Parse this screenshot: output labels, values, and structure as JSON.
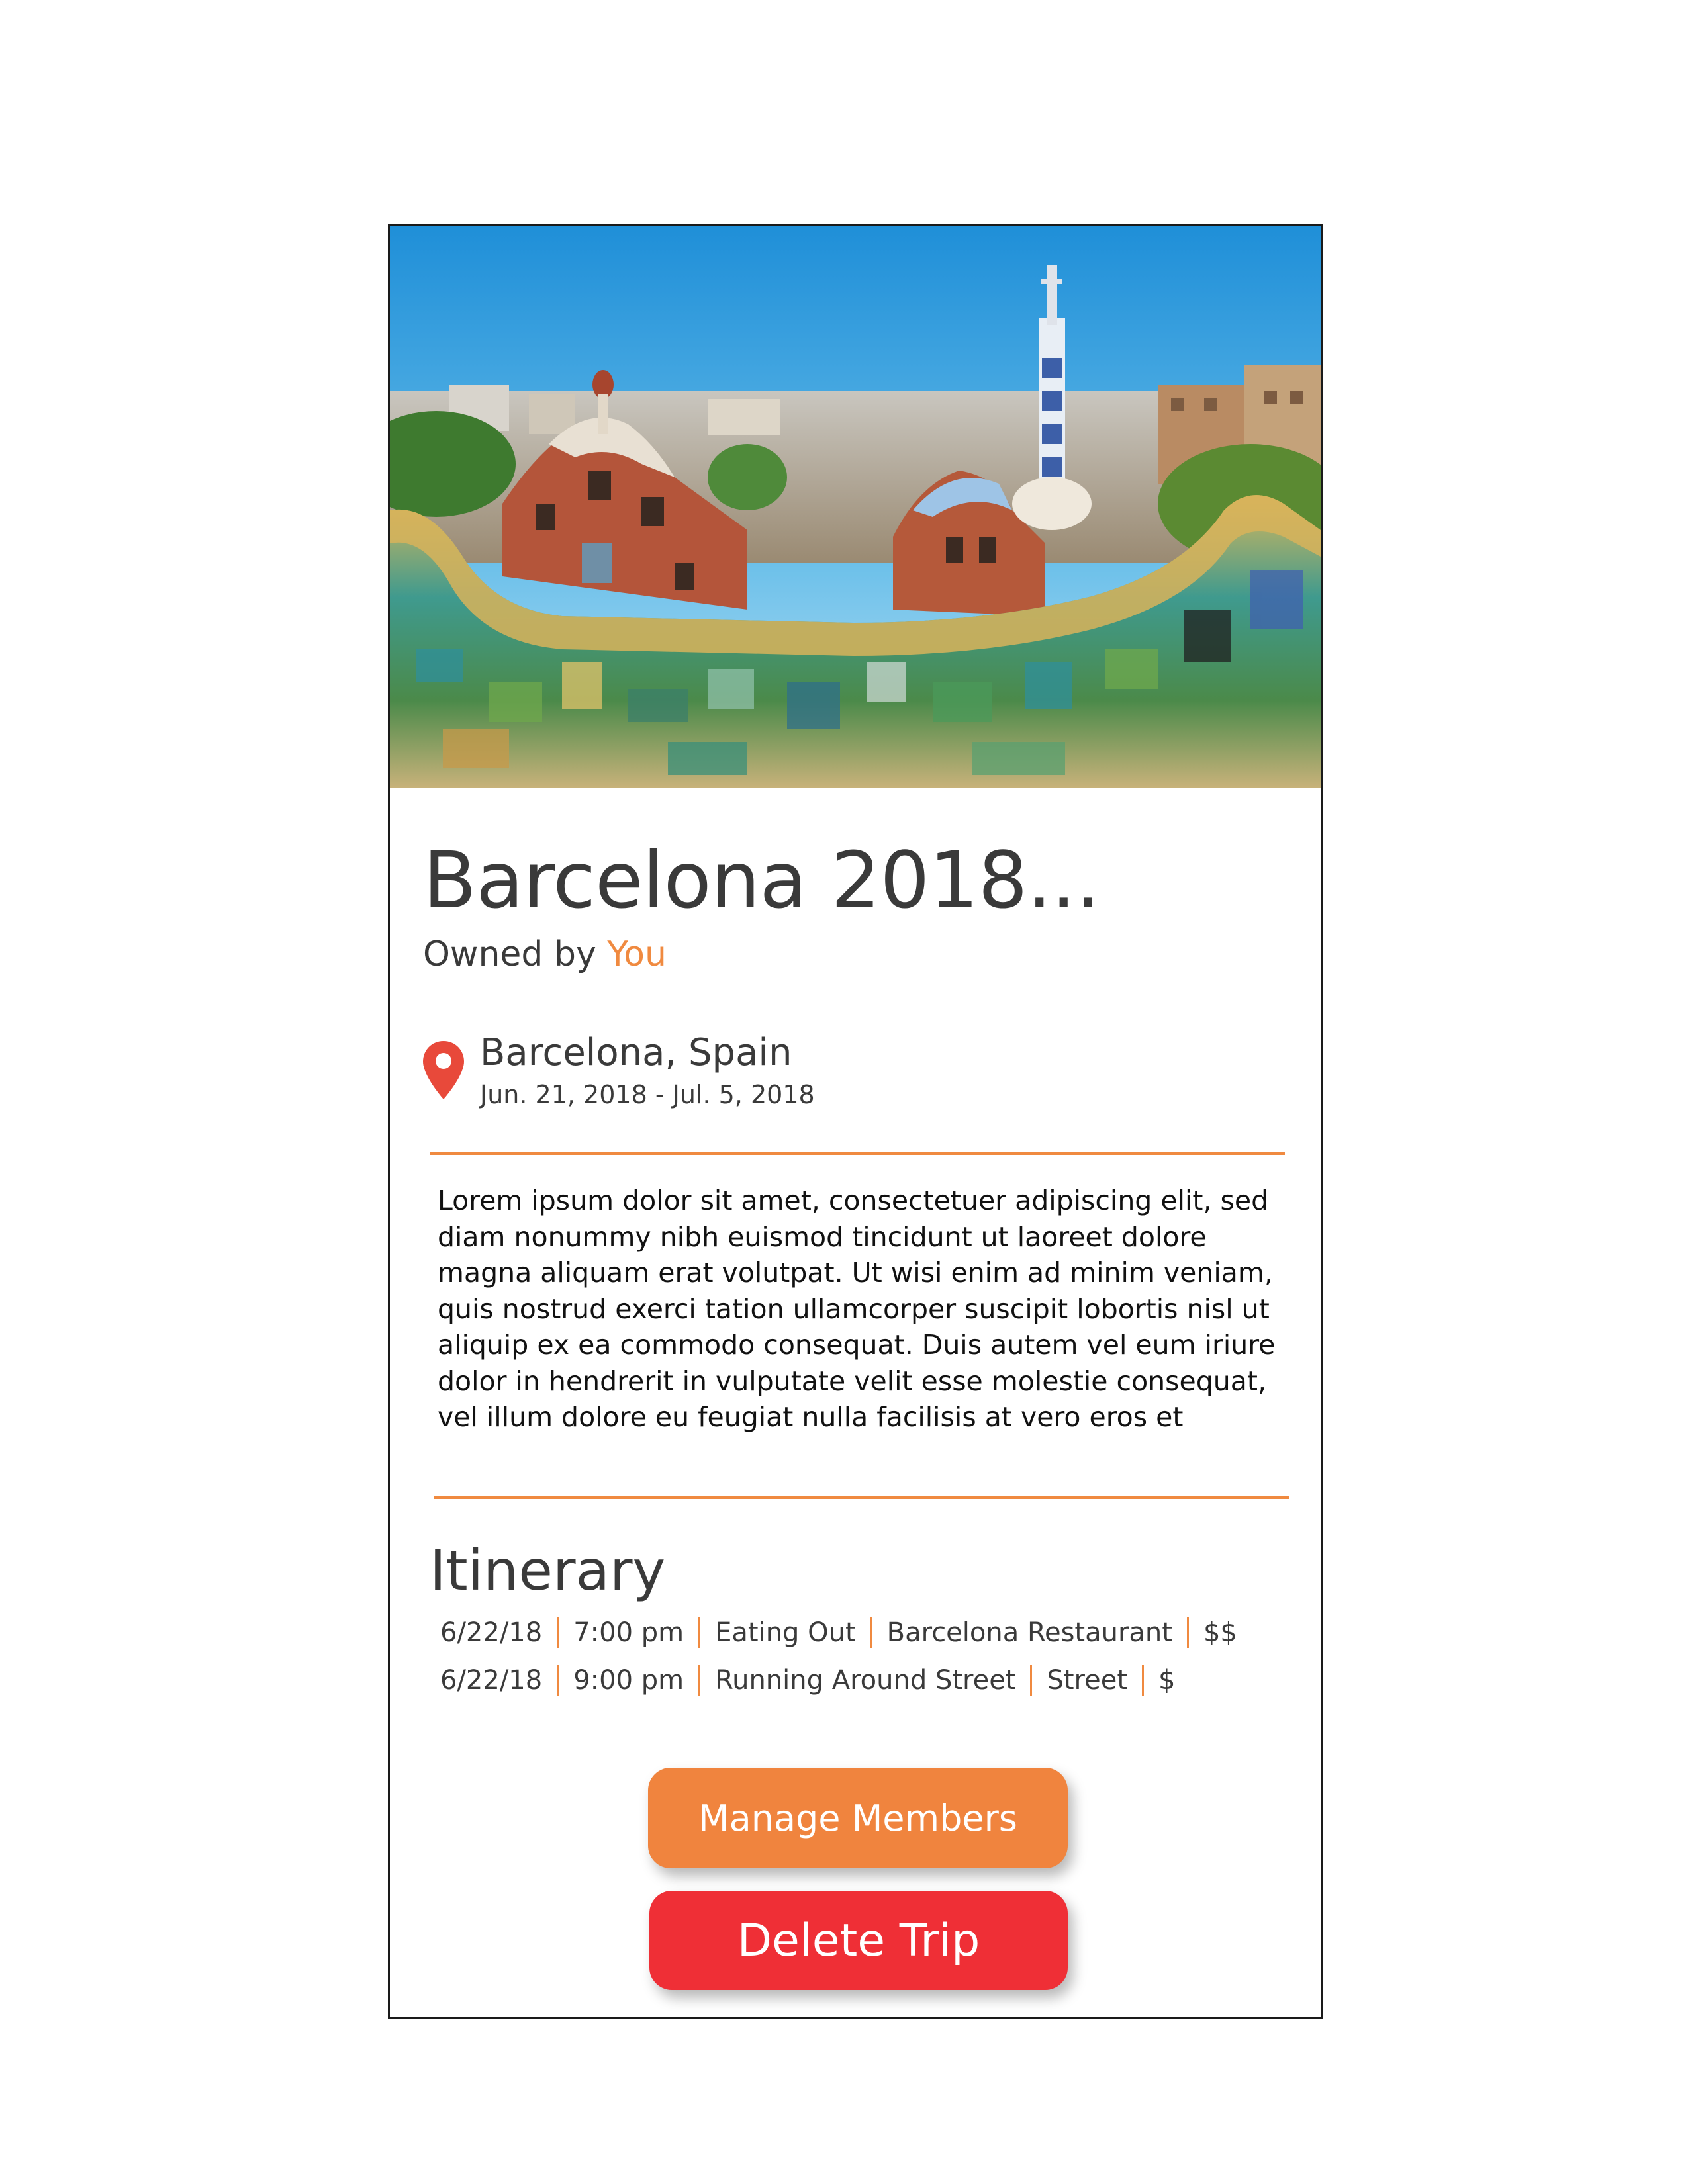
{
  "trip": {
    "title": "Barcelona 2018...",
    "owned_by_label": "Owned by",
    "owner": "You"
  },
  "location": {
    "icon": "map-pin-icon",
    "name": "Barcelona, Spain",
    "dates": "Jun. 21, 2018 - Jul. 5, 2018"
  },
  "description": "Lorem ipsum dolor sit amet, consectetuer adipiscing elit, sed diam nonummy nibh euismod tincidunt ut laoreet dolore magna aliquam erat volutpat. Ut wisi enim ad minim veniam, quis nostrud exerci tation ullamcorper suscipit lobortis nisl ut aliquip ex ea commodo consequat. Duis autem vel eum iriure dolor in hendrerit in vulputate velit esse molestie consequat, vel illum dolore eu feugiat nulla facilisis at vero eros et",
  "itinerary": {
    "heading": "Itinerary",
    "items": [
      {
        "date": "6/22/18",
        "time": "7:00 pm",
        "activity": "Eating Out",
        "place": "Barcelona Restaurant",
        "cost": "$$"
      },
      {
        "date": "6/22/18",
        "time": "9:00 pm",
        "activity": "Running Around Street",
        "place": "Street",
        "cost": "$"
      }
    ]
  },
  "buttons": {
    "manage_members": "Manage Members",
    "delete_trip": "Delete Trip"
  },
  "colors": {
    "accent": "#f08a40",
    "danger": "#ef2f36",
    "text": "#3a3a3a"
  }
}
